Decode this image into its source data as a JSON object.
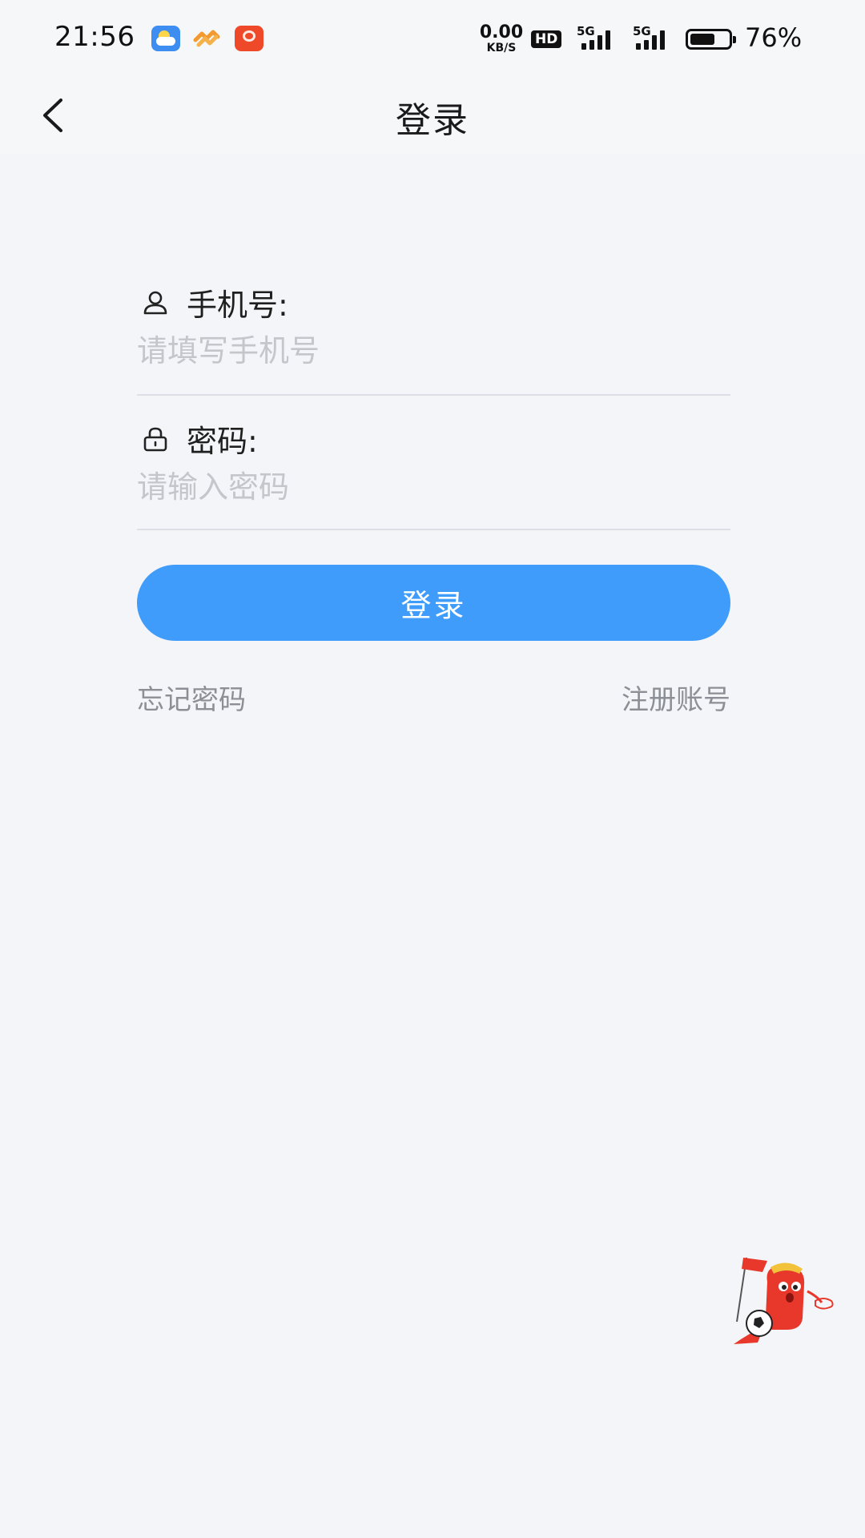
{
  "status_bar": {
    "time": "21:56",
    "net_speed_value": "0.00",
    "net_speed_unit": "KB/S",
    "hd_label": "HD",
    "signal_1_label": "5G",
    "signal_2_label": "5G",
    "battery_percent": "76%",
    "battery_level": 0.76,
    "notification_icons": [
      "weather-app-icon",
      "health-app-icon",
      "red-app-icon"
    ]
  },
  "header": {
    "title": "登录",
    "back_icon": "chevron-left-icon"
  },
  "form": {
    "phone_label": "手机号:",
    "phone_icon": "user-icon",
    "phone_placeholder": "请填写手机号",
    "password_label": "密码:",
    "password_icon": "lock-icon",
    "password_placeholder": "请输入密码"
  },
  "actions": {
    "login_label": "登录",
    "forgot_password_label": "忘记密码",
    "register_label": "注册账号"
  },
  "colors": {
    "accent": "#3f9cfb",
    "background": "#f3f5f8",
    "placeholder": "#c4c6cb",
    "link": "#8c8f95"
  }
}
